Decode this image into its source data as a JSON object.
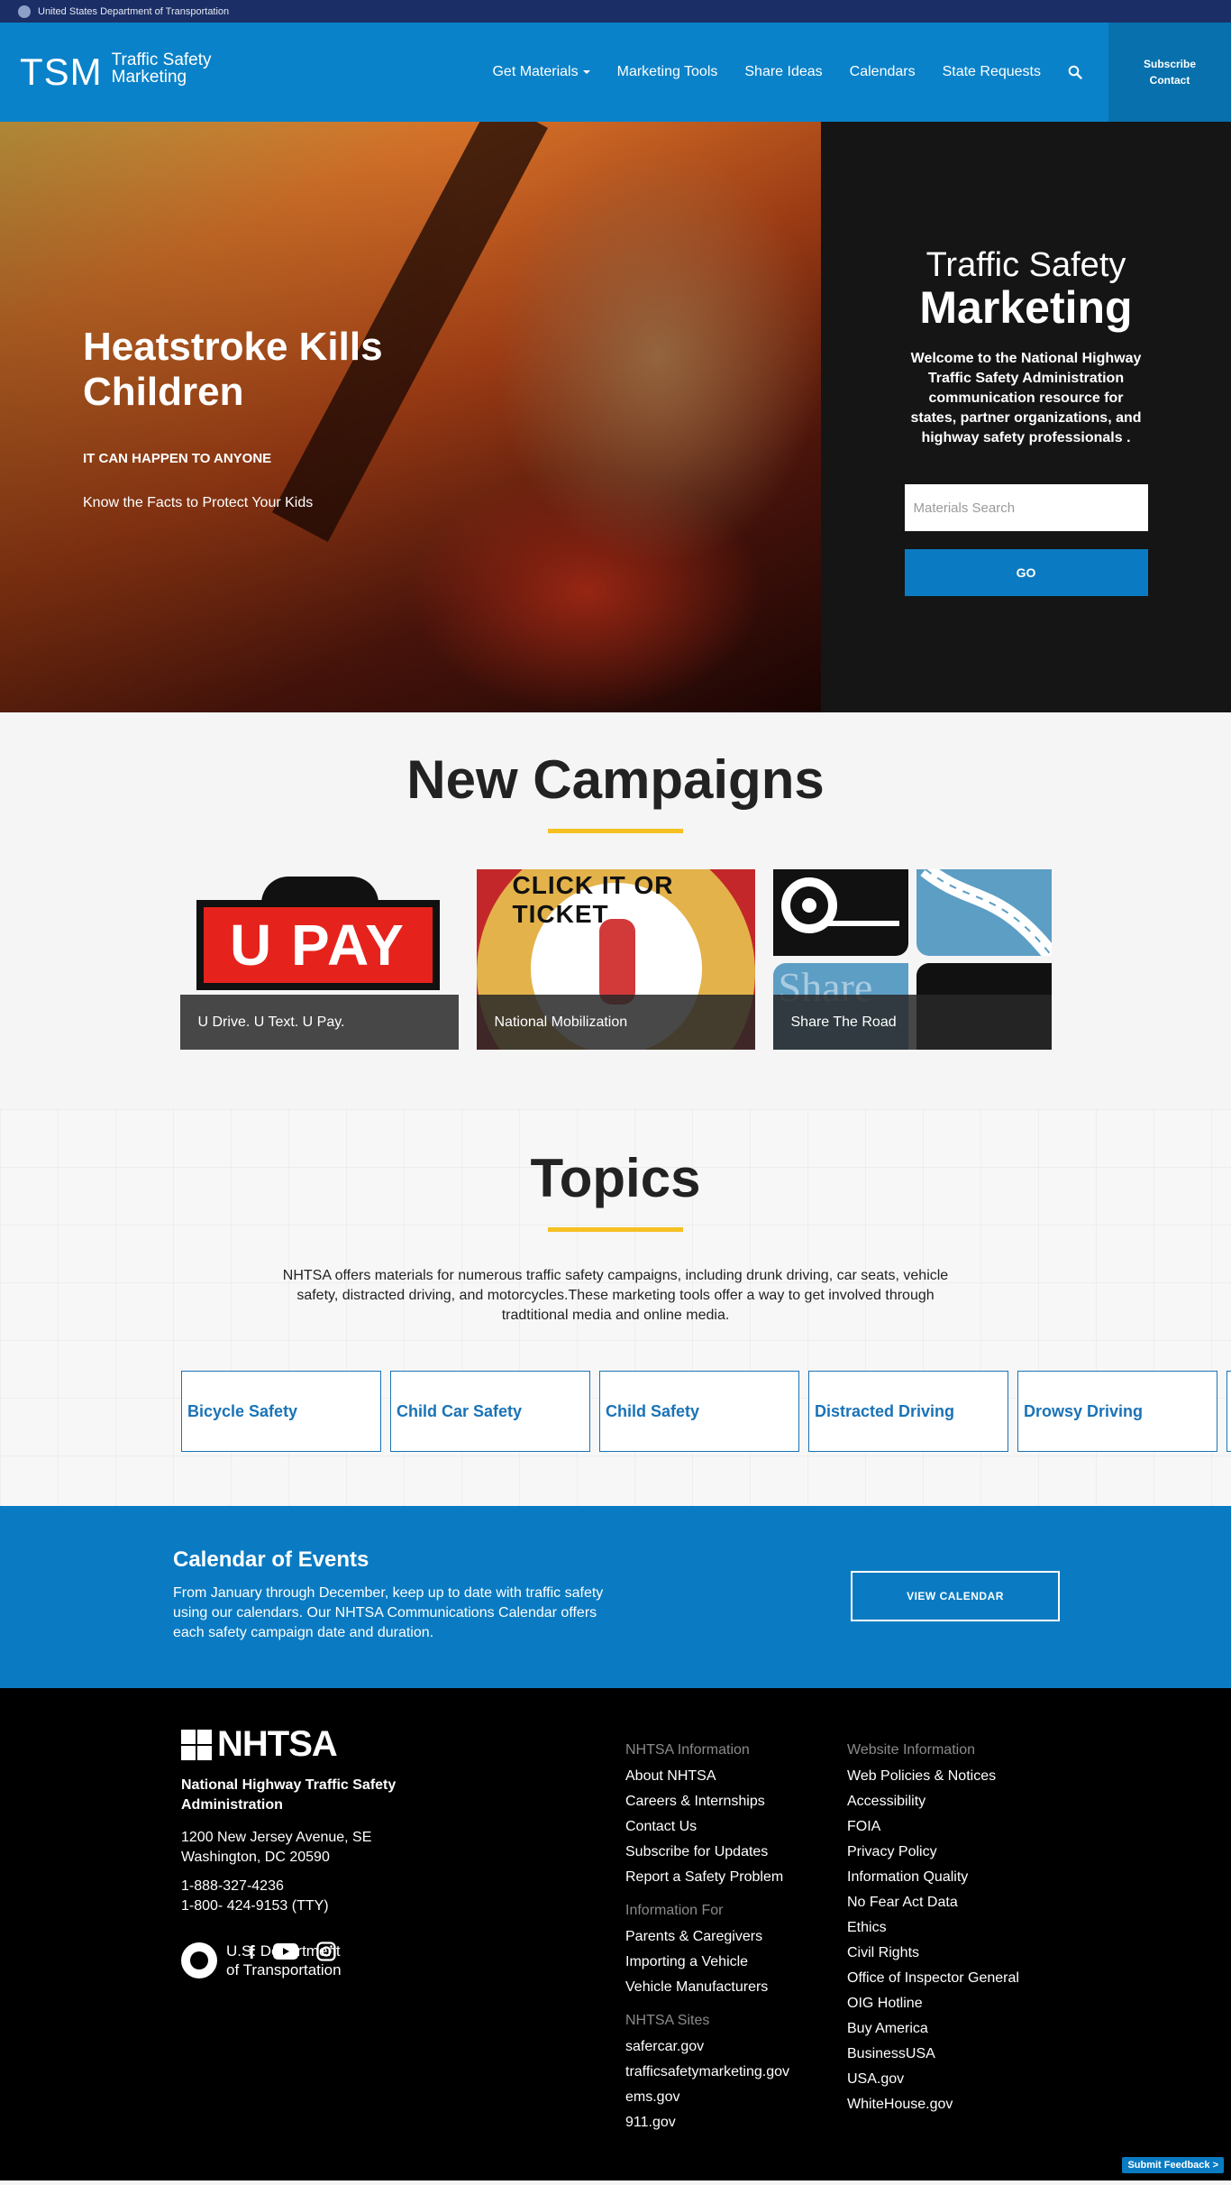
{
  "gov_bar": {
    "text": "United States Department of Transportation"
  },
  "header": {
    "logo_abbr": "TSM",
    "logo_line1": "Traffic Safety",
    "logo_line2": "Marketing",
    "nav": [
      {
        "label": "Get Materials"
      },
      {
        "label": "Marketing Tools"
      },
      {
        "label": "Share Ideas"
      },
      {
        "label": "Calendars"
      },
      {
        "label": "State Requests"
      }
    ],
    "search_icon": "search-icon",
    "subscribe": "Subscribe",
    "contact": "Contact"
  },
  "hero": {
    "title": "Heatstroke Kills Children",
    "kicker": "IT CAN HAPPEN TO ANYONE",
    "link": "Know the Facts to Protect Your Kids",
    "side_title_1": "Traffic Safety",
    "side_title_2": "Marketing",
    "side_desc": "Welcome to the National Highway Traffic Safety Administration communication resource for states, partner organizations, and highway safety professionals .",
    "search_placeholder": "Materials Search",
    "go_label": "GO"
  },
  "campaigns": {
    "title": "New Campaigns",
    "cards": [
      {
        "caption": "U Drive. U Text. U Pay.",
        "art_text": "U PAY"
      },
      {
        "caption": "National Mobilization",
        "art_text": "CLICK IT OR TICKET"
      },
      {
        "caption": "Share The Road",
        "art_text": "Share"
      }
    ]
  },
  "topics": {
    "title": "Topics",
    "desc": "NHTSA offers materials for numerous traffic safety campaigns, including drunk driving, car seats, vehicle safety, distracted driving, and motorcycles.These marketing tools offer a way to get involved through tradtitional media and online media.",
    "items": [
      "Bicycle Safety",
      "Child Car Safety",
      "Child Safety",
      "Distracted Driving",
      "Drowsy Driving"
    ]
  },
  "calendar": {
    "title": "Calendar of Events",
    "desc": "From January through December, keep up to date with traffic safety using our calendars. Our NHTSA Communications Calendar offers each safety campaign date and duration.",
    "button": "VIEW CALENDAR"
  },
  "footer": {
    "logo": "NHTSA",
    "org": "National Highway Traffic Safety Administration",
    "addr1": "1200 New Jersey Avenue, SE",
    "addr2": "Washington, DC 20590",
    "phone1": "1-888-327-4236",
    "phone2": "1-800- 424-9153 (TTY)",
    "dot1": "U.S. Department",
    "dot2": "of Transportation",
    "col1": {
      "h1": "NHTSA Information",
      "links1": [
        "About NHTSA",
        "Careers & Internships",
        "Contact Us",
        "Subscribe for Updates",
        "Report a Safety Problem"
      ],
      "h2": "Information For",
      "links2": [
        "Parents & Caregivers",
        "Importing a Vehicle",
        "Vehicle Manufacturers"
      ],
      "h3": "NHTSA Sites",
      "links3": [
        "safercar.gov",
        "trafficsafetymarketing.gov",
        "ems.gov",
        "911.gov"
      ]
    },
    "col2": {
      "h1": "Website Information",
      "links1": [
        "Web Policies & Notices",
        "Accessibility",
        "FOIA",
        "Privacy Policy",
        "Information Quality",
        "No Fear Act Data",
        "Ethics",
        "Civil Rights",
        "Office of Inspector General",
        "OIG Hotline",
        "Buy America",
        "BusinessUSA",
        "USA.gov",
        "WhiteHouse.gov"
      ]
    },
    "feedback": "Submit Feedback >"
  },
  "colors": {
    "brand_blue": "#0a82c9",
    "accent_yellow": "#f6c022",
    "gov_navy": "#1b2f66"
  }
}
